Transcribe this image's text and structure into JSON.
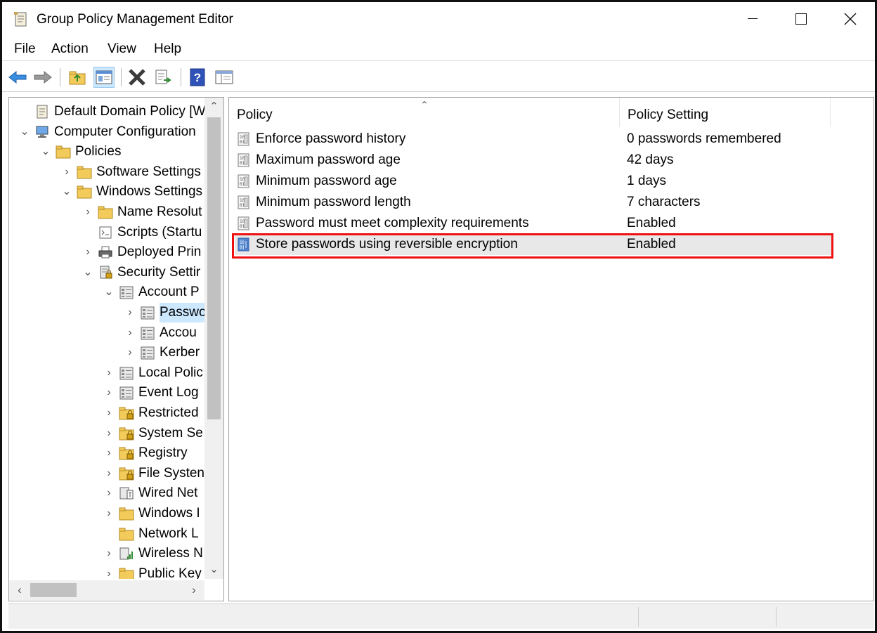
{
  "window": {
    "title": "Group Policy Management Editor",
    "minimize": "—",
    "maximize": "☐",
    "close": "✕"
  },
  "menu": [
    "File",
    "Action",
    "View",
    "Help"
  ],
  "toolbar": [
    "back-icon",
    "forward-icon",
    "up-folder-icon",
    "show-hide-tree-icon",
    "delete-icon",
    "export-list-icon",
    "help-icon",
    "properties-pane-icon"
  ],
  "tree": [
    {
      "label": "Default Domain Policy [WIN",
      "depth": 0,
      "chevron": "",
      "icon": "policy-doc-icon"
    },
    {
      "label": "Computer Configuration",
      "depth": 0,
      "chevron": "⌄",
      "icon": "computer-icon"
    },
    {
      "label": "Policies",
      "depth": 1,
      "chevron": "⌄",
      "icon": "folder-icon"
    },
    {
      "label": "Software Settings",
      "depth": 2,
      "chevron": "›",
      "icon": "folder-icon"
    },
    {
      "label": "Windows Settings",
      "depth": 2,
      "chevron": "⌄",
      "icon": "folder-icon"
    },
    {
      "label": "Name Resolut",
      "depth": 3,
      "chevron": "›",
      "icon": "folder-icon"
    },
    {
      "label": "Scripts (Startu",
      "depth": 3,
      "chevron": "",
      "icon": "scripts-icon"
    },
    {
      "label": "Deployed Prin",
      "depth": 3,
      "chevron": "›",
      "icon": "printer-icon"
    },
    {
      "label": "Security Settir",
      "depth": 3,
      "chevron": "⌄",
      "icon": "security-settings-icon"
    },
    {
      "label": "Account P",
      "depth": 4,
      "chevron": "⌄",
      "icon": "policy-list-icon"
    },
    {
      "label": "Passwo",
      "depth": 5,
      "chevron": "›",
      "icon": "policy-list-icon",
      "selected": true
    },
    {
      "label": "Accou",
      "depth": 5,
      "chevron": "›",
      "icon": "policy-list-icon"
    },
    {
      "label": "Kerber",
      "depth": 5,
      "chevron": "›",
      "icon": "policy-list-icon"
    },
    {
      "label": "Local Polic",
      "depth": 4,
      "chevron": "›",
      "icon": "policy-list-icon"
    },
    {
      "label": "Event Log",
      "depth": 4,
      "chevron": "›",
      "icon": "policy-list-icon"
    },
    {
      "label": "Restricted",
      "depth": 4,
      "chevron": "›",
      "icon": "locked-folder-icon"
    },
    {
      "label": "System Se",
      "depth": 4,
      "chevron": "›",
      "icon": "locked-folder-icon"
    },
    {
      "label": "Registry",
      "depth": 4,
      "chevron": "›",
      "icon": "locked-folder-icon"
    },
    {
      "label": "File Systen",
      "depth": 4,
      "chevron": "›",
      "icon": "locked-folder-icon"
    },
    {
      "label": "Wired Net",
      "depth": 4,
      "chevron": "›",
      "icon": "wired-network-icon"
    },
    {
      "label": "Windows I",
      "depth": 4,
      "chevron": "›",
      "icon": "folder-icon"
    },
    {
      "label": "Network L",
      "depth": 4,
      "chevron": "",
      "icon": "folder-icon"
    },
    {
      "label": "Wireless N",
      "depth": 4,
      "chevron": "›",
      "icon": "wireless-network-icon"
    },
    {
      "label": "Public Key",
      "depth": 4,
      "chevron": "›",
      "icon": "folder-icon"
    }
  ],
  "list": {
    "columns": {
      "policy": "Policy",
      "setting": "Policy Setting"
    },
    "rows": [
      {
        "policy": "Enforce password history",
        "setting": "0 passwords remembered"
      },
      {
        "policy": "Maximum password age",
        "setting": "42 days"
      },
      {
        "policy": "Minimum password age",
        "setting": "1 days"
      },
      {
        "policy": "Minimum password length",
        "setting": "7 characters"
      },
      {
        "policy": "Password must meet complexity requirements",
        "setting": "Enabled"
      },
      {
        "policy": "Store passwords using reversible encryption",
        "setting": "Enabled",
        "highlighted": true
      }
    ]
  },
  "colors": {
    "selection": "#cce8ff",
    "highlight_box": "#ee1111",
    "folder": "#f2cb5a"
  }
}
